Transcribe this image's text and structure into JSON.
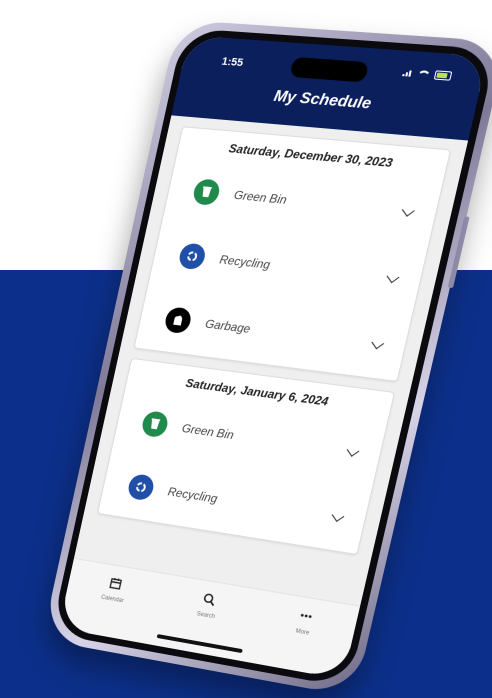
{
  "status_bar": {
    "time": "1:55"
  },
  "header": {
    "title": "My Schedule"
  },
  "colors": {
    "band": "#0b2f8a",
    "header": "#0a1f5c",
    "green_bin": "#1f8a4c",
    "recycling": "#1f4fa8",
    "garbage": "#000000"
  },
  "schedule": [
    {
      "date": "Saturday, December 30, 2023",
      "items": [
        {
          "label": "Green Bin",
          "icon": "green-bin-icon"
        },
        {
          "label": "Recycling",
          "icon": "recycling-icon"
        },
        {
          "label": "Garbage",
          "icon": "garbage-icon"
        }
      ]
    },
    {
      "date": "Saturday, January 6, 2024",
      "items": [
        {
          "label": "Green Bin",
          "icon": "green-bin-icon"
        },
        {
          "label": "Recycling",
          "icon": "recycling-icon"
        }
      ]
    }
  ],
  "tabbar": {
    "tabs": [
      {
        "label": "Calendar",
        "icon": "calendar-icon"
      },
      {
        "label": "Search",
        "icon": "search-icon"
      },
      {
        "label": "More",
        "icon": "more-icon"
      }
    ]
  }
}
